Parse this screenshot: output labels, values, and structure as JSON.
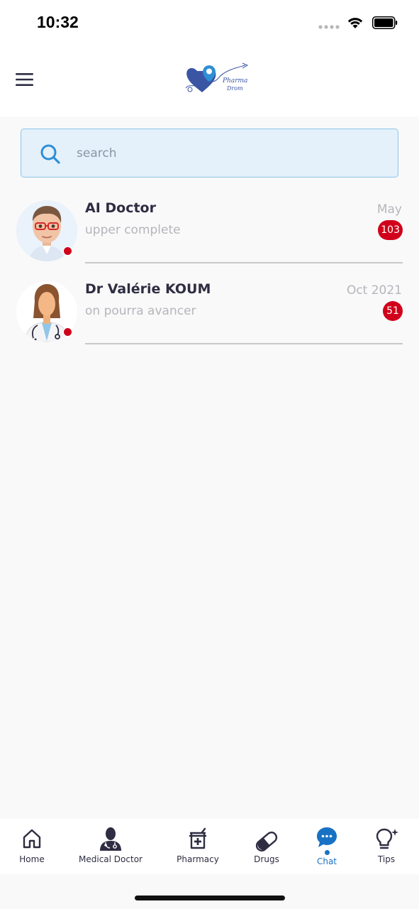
{
  "status_bar": {
    "time": "10:32"
  },
  "header": {
    "logo_text": "Pharma Drom"
  },
  "search": {
    "placeholder": "search",
    "value": ""
  },
  "chats": [
    {
      "name": "AI Doctor",
      "preview": "upper complete",
      "date": "May",
      "unread": "103",
      "online_status": "offline"
    },
    {
      "name": "Dr Valérie KOUM",
      "preview": "on pourra avancer",
      "date": "Oct 2021",
      "unread": "51",
      "online_status": "offline"
    }
  ],
  "bottom_nav": {
    "items": [
      {
        "label": "Home",
        "icon": "home-icon"
      },
      {
        "label": "Medical Doctor",
        "icon": "doctor-icon"
      },
      {
        "label": "Pharmacy",
        "icon": "pharmacy-icon"
      },
      {
        "label": "Drugs",
        "icon": "pill-icon"
      },
      {
        "label": "Chat",
        "icon": "chat-icon",
        "active": true
      },
      {
        "label": "Tips",
        "icon": "lightbulb-icon"
      }
    ]
  },
  "colors": {
    "accent": "#1872c4",
    "badge": "#d0021b",
    "text_primary": "#2e2d42",
    "text_muted": "#b5b5bc",
    "search_bg": "#e4f1fb"
  }
}
